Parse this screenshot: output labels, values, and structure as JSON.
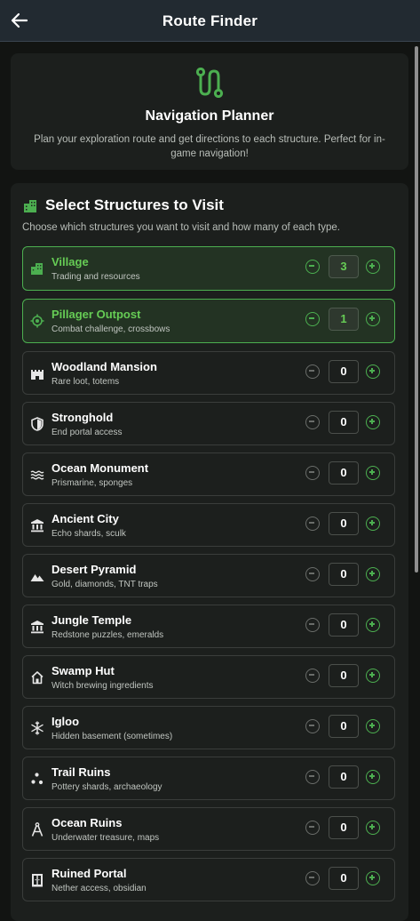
{
  "header": {
    "title": "Route Finder"
  },
  "intro": {
    "title": "Navigation Planner",
    "description": "Plan your exploration route and get directions to each structure. Perfect for in-game navigation!"
  },
  "structures": {
    "title": "Select Structures to Visit",
    "description": "Choose which structures you want to visit and how many of each type.",
    "items": [
      {
        "name": "Village",
        "desc": "Trading and resources",
        "qty": "3",
        "icon": "village-icon",
        "selected": true
      },
      {
        "name": "Pillager Outpost",
        "desc": "Combat challenge, crossbows",
        "qty": "1",
        "icon": "crosshair-icon",
        "selected": true
      },
      {
        "name": "Woodland Mansion",
        "desc": "Rare loot, totems",
        "qty": "0",
        "icon": "castle-icon",
        "selected": false
      },
      {
        "name": "Stronghold",
        "desc": "End portal access",
        "qty": "0",
        "icon": "shield-icon",
        "selected": false
      },
      {
        "name": "Ocean Monument",
        "desc": "Prismarine, sponges",
        "qty": "0",
        "icon": "waves-icon",
        "selected": false
      },
      {
        "name": "Ancient City",
        "desc": "Echo shards, sculk",
        "qty": "0",
        "icon": "museum-icon",
        "selected": false
      },
      {
        "name": "Desert Pyramid",
        "desc": "Gold, diamonds, TNT traps",
        "qty": "0",
        "icon": "mountain-icon",
        "selected": false
      },
      {
        "name": "Jungle Temple",
        "desc": "Redstone puzzles, emeralds",
        "qty": "0",
        "icon": "temple-icon",
        "selected": false
      },
      {
        "name": "Swamp Hut",
        "desc": "Witch brewing ingredients",
        "qty": "0",
        "icon": "house-icon",
        "selected": false
      },
      {
        "name": "Igloo",
        "desc": "Hidden basement (sometimes)",
        "qty": "0",
        "icon": "snowflake-icon",
        "selected": false
      },
      {
        "name": "Trail Ruins",
        "desc": "Pottery shards, archaeology",
        "qty": "0",
        "icon": "scatter-dots-icon",
        "selected": false
      },
      {
        "name": "Ocean Ruins",
        "desc": "Underwater treasure, maps",
        "qty": "0",
        "icon": "compass-icon",
        "selected": false
      },
      {
        "name": "Ruined Portal",
        "desc": "Nether access, obsidian",
        "qty": "0",
        "icon": "portal-door-icon",
        "selected": false
      }
    ]
  },
  "colors": {
    "accent": "#4caf50",
    "accent_text": "#66cc55",
    "background": "#121412",
    "card": "#1c1f1d",
    "header": "#222a31"
  }
}
